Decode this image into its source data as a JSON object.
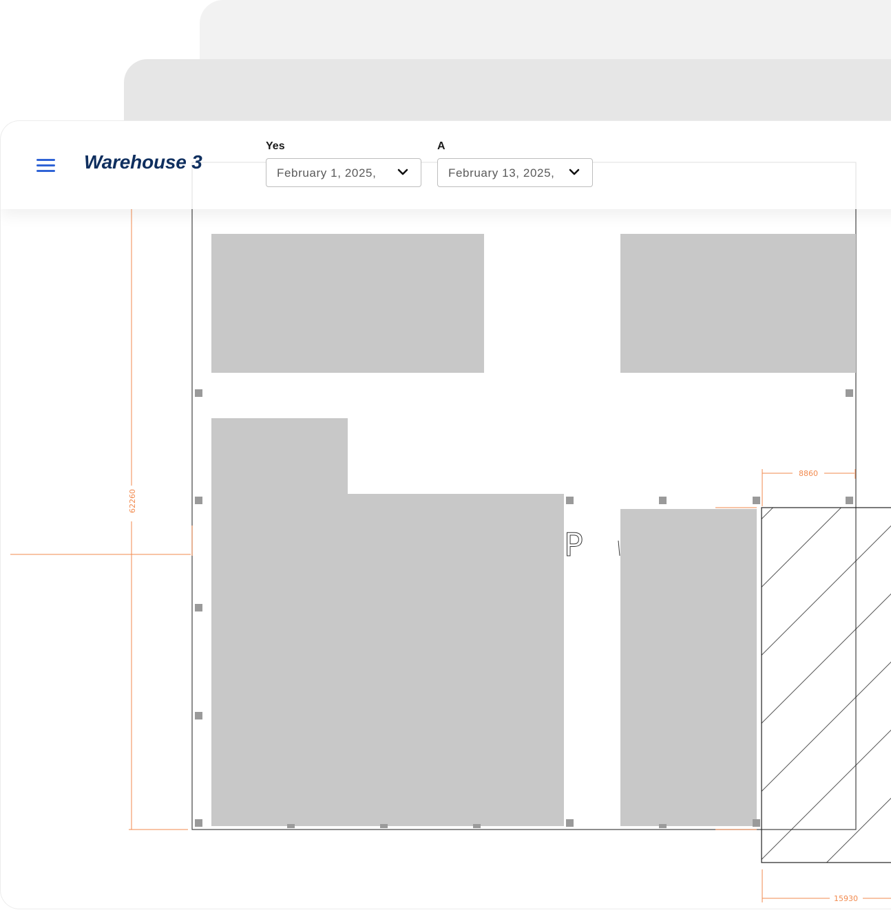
{
  "app": {
    "title": "Warehouse 3"
  },
  "header": {
    "menu_icon": "hamburger-menu-icon",
    "start_date": {
      "label": "Yes",
      "value": "February 1, 2025,"
    },
    "end_date": {
      "label": "A",
      "value": "February 13, 2025,"
    }
  },
  "floor_plan": {
    "dimensions": {
      "height_label": "62260",
      "top_right_width": "8860",
      "bottom_right_width": "15930"
    },
    "zone_label_partial": "P"
  },
  "colors": {
    "accent": "#2f63d6",
    "title": "#0f2f5f",
    "dimension": "#f28a4e",
    "zone_fill": "#c8c8c8",
    "column_marker": "#9a9a9a",
    "outline": "#333333"
  }
}
